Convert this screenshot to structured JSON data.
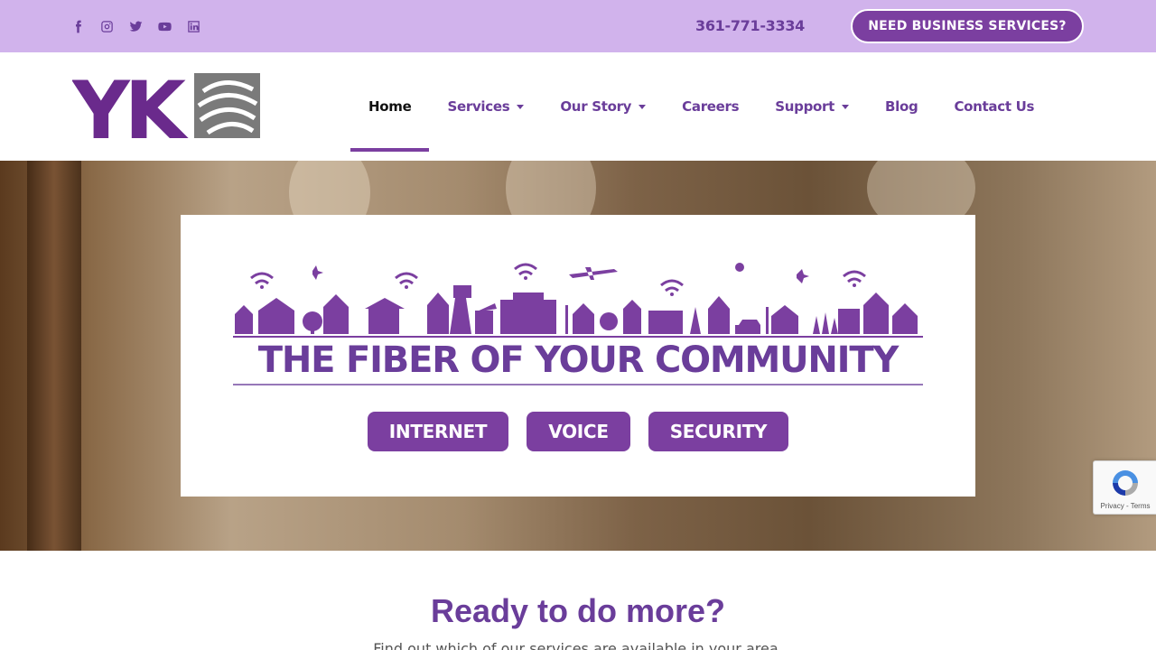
{
  "colors": {
    "topbar_bg": "#d1b3ec",
    "brand_purple": "#7b3fa0",
    "text_purple": "#6a3d9a"
  },
  "topbar": {
    "social_icons": [
      "facebook-icon",
      "instagram-icon",
      "twitter-icon",
      "youtube-icon",
      "linkedin-icon"
    ],
    "phone": "361-771-3334",
    "business_button": "NEED BUSINESS SERVICES?"
  },
  "header": {
    "logo_text": "YK",
    "nav": [
      {
        "label": "Home",
        "active": true,
        "dropdown": false
      },
      {
        "label": "Services",
        "active": false,
        "dropdown": true
      },
      {
        "label": "Our Story",
        "active": false,
        "dropdown": true
      },
      {
        "label": "Careers",
        "active": false,
        "dropdown": false
      },
      {
        "label": "Support",
        "active": false,
        "dropdown": true
      },
      {
        "label": "Blog",
        "active": false,
        "dropdown": false
      },
      {
        "label": "Contact Us",
        "active": false,
        "dropdown": false
      }
    ]
  },
  "hero": {
    "tagline": "THE FIBER OF YOUR COMMUNITY",
    "buttons": [
      "INTERNET",
      "VOICE",
      "SECURITY"
    ]
  },
  "recaptcha": {
    "text": "Privacy - Terms"
  },
  "cta": {
    "title": "Ready to do more?",
    "subtitle": "Find out which of our services are available in your area."
  }
}
